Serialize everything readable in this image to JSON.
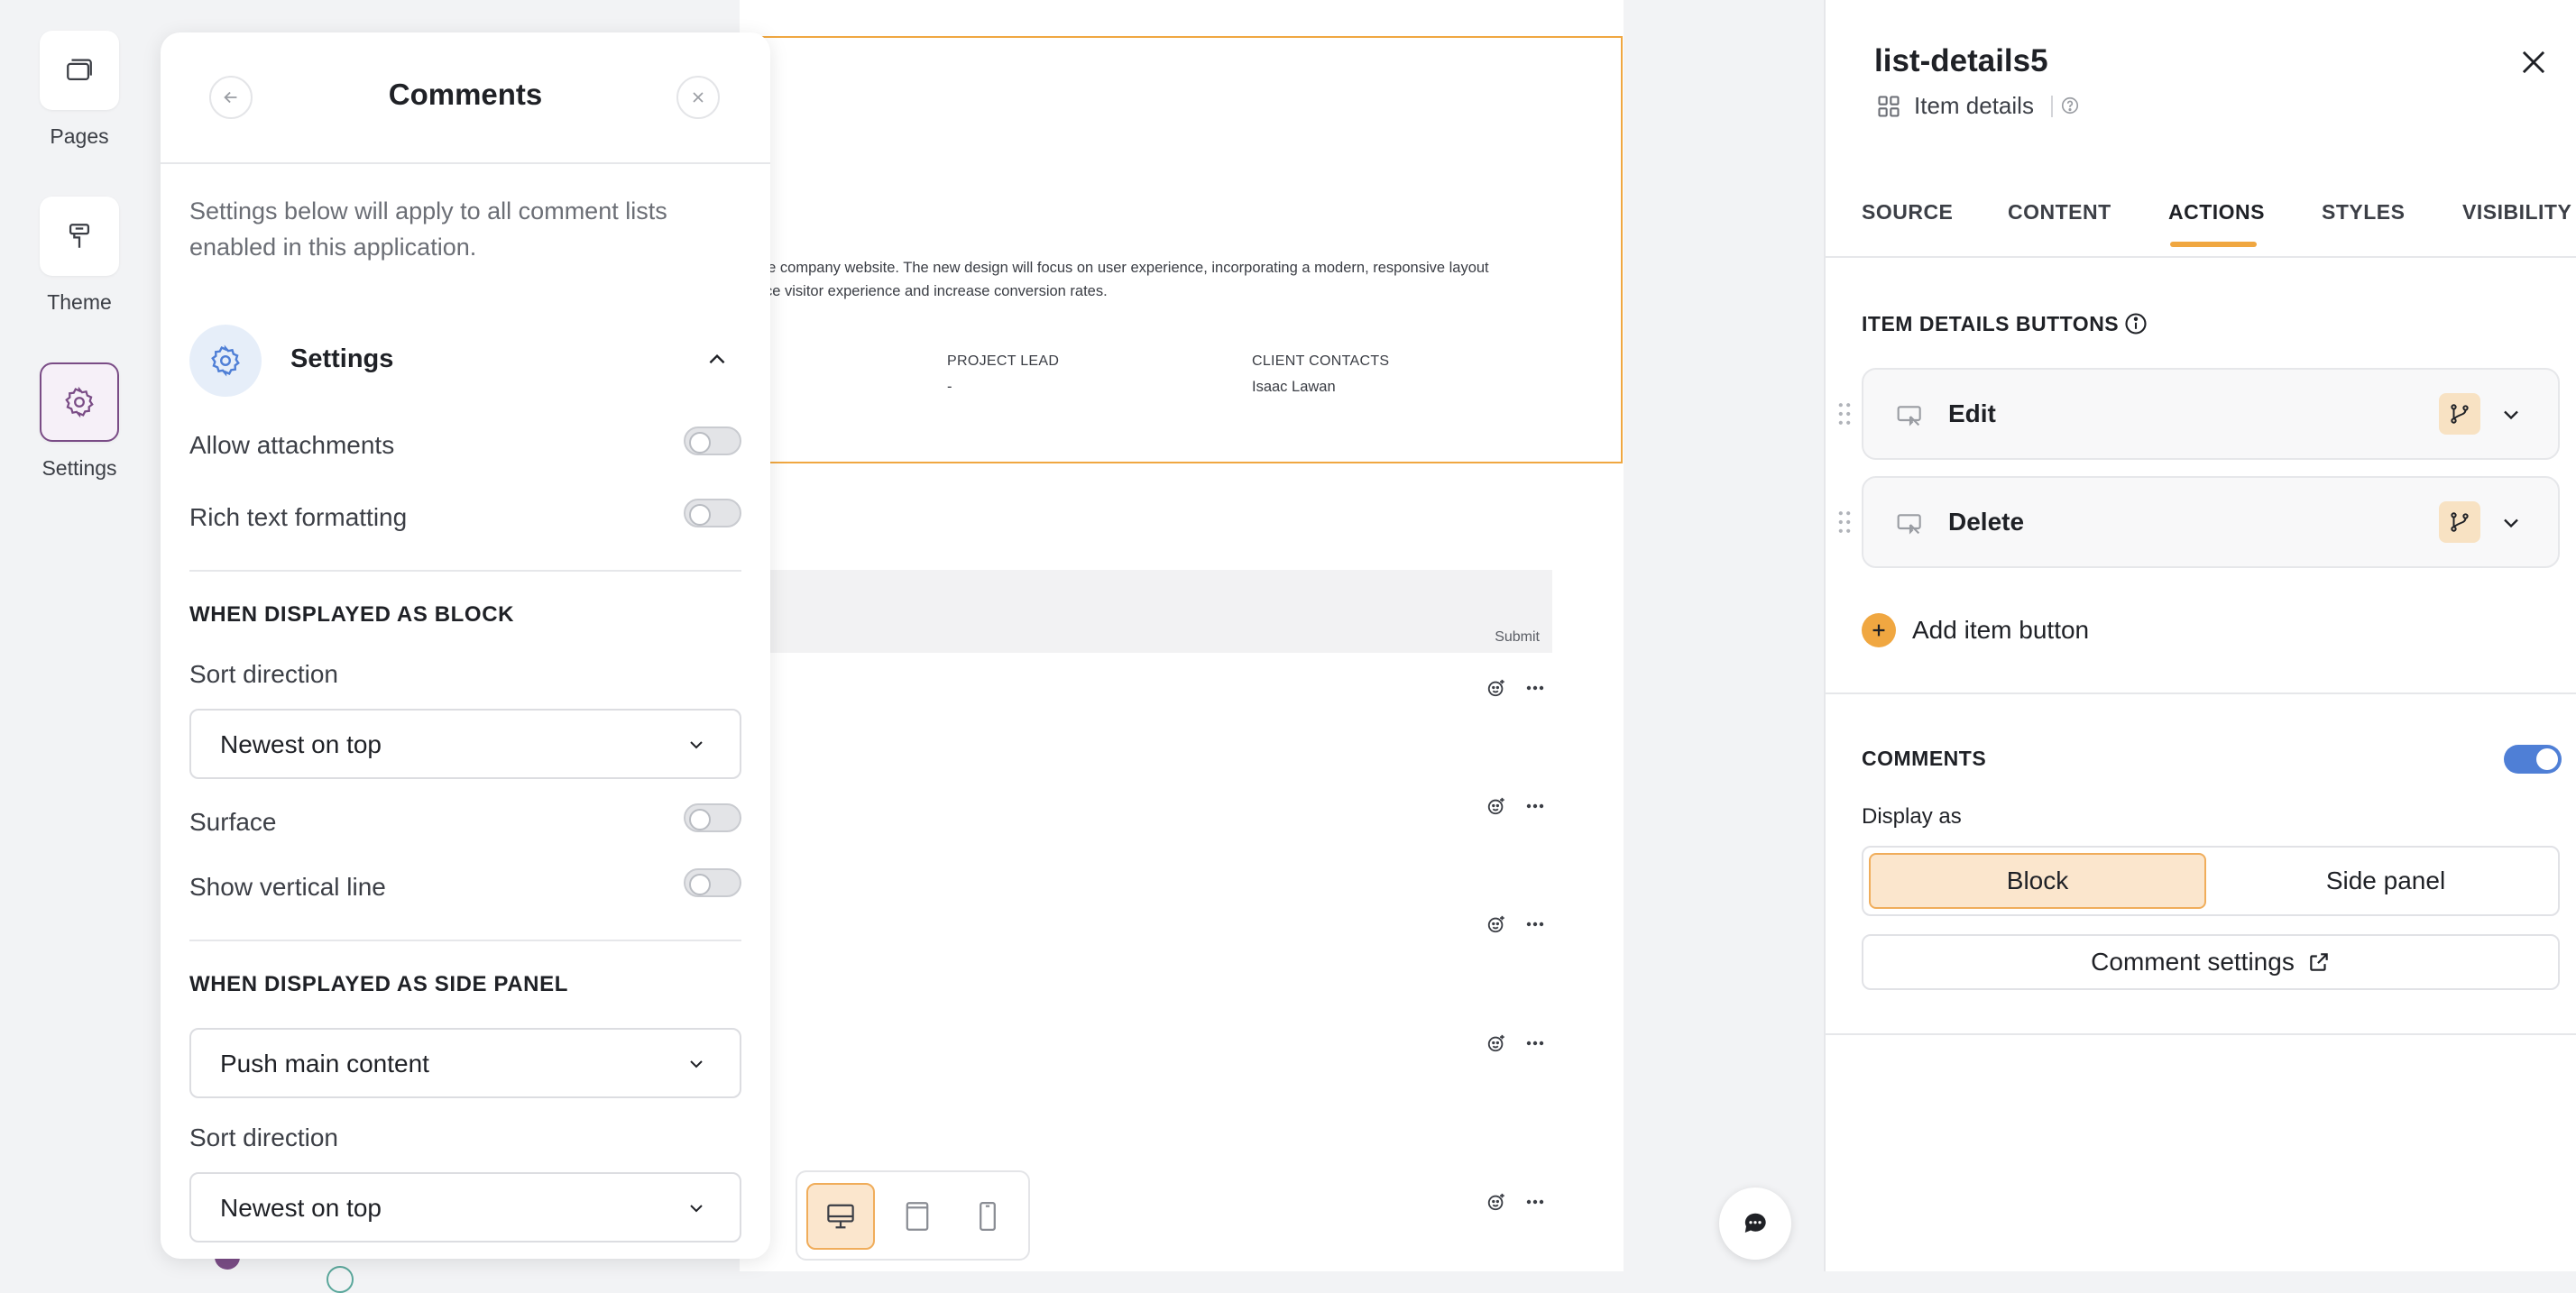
{
  "rail": {
    "pages_label": "Pages",
    "theme_label": "Theme",
    "settings_label": "Settings"
  },
  "canvas": {
    "description_line1": "ne company website. The new design will focus on user experience, incorporating a modern, responsive layout",
    "description_line2": "ce visitor experience and increase conversion rates.",
    "project_lead_label": "PROJECT LEAD",
    "project_lead_value": "-",
    "client_contacts_label": "CLIENT CONTACTS",
    "client_contacts_value": "Isaac Lawan",
    "submit_label": "Submit"
  },
  "comments_panel": {
    "title": "Comments",
    "intro": "Settings below will apply to all comment lists enabled in this application.",
    "settings_heading": "Settings",
    "allow_attachments_label": "Allow attachments",
    "rich_text_label": "Rich text formatting",
    "block_section": "WHEN DISPLAYED AS BLOCK",
    "block_sort_label": "Sort direction",
    "block_sort_value": "Newest on top",
    "surface_label": "Surface",
    "vertical_line_label": "Show vertical line",
    "side_section": "WHEN DISPLAYED AS SIDE PANEL",
    "side_mode_value": "Push main content",
    "side_sort_label": "Sort direction",
    "side_sort_value": "Newest on top"
  },
  "right_panel": {
    "title": "list-details5",
    "subtitle": "Item details",
    "tabs": [
      "SOURCE",
      "CONTENT",
      "ACTIONS",
      "STYLES",
      "VISIBILITY"
    ],
    "active_tab": "ACTIONS",
    "buttons_section": "ITEM DETAILS BUTTONS",
    "buttons": [
      {
        "label": "Edit"
      },
      {
        "label": "Delete"
      }
    ],
    "add_button_label": "Add item button",
    "comments_section": "COMMENTS",
    "comments_enabled": true,
    "display_as_label": "Display as",
    "display_options": [
      "Block",
      "Side panel"
    ],
    "display_selected": "Block",
    "comment_settings_label": "Comment settings"
  },
  "colors": {
    "accent_orange": "#f0a741",
    "toggle_on": "#4f7fd6",
    "settings_purple": "#7a4c86"
  }
}
